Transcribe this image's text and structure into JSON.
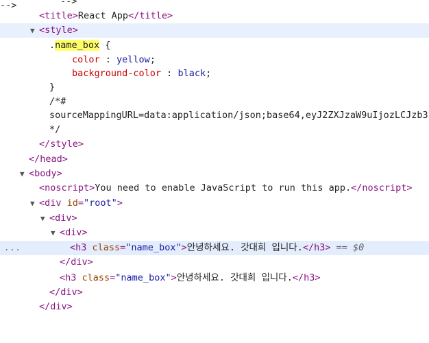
{
  "lines": {
    "comment_close": "-->",
    "title_open": "<title>",
    "title_text": "React App",
    "title_close": "</title>",
    "style_open": "<style>",
    "css_dot": ".",
    "css_selector": "name_box",
    "css_brace_open": " {",
    "css_prop_color": "color",
    "css_sep": " : ",
    "css_val_color": "yellow",
    "css_semicolon": ";",
    "css_prop_bg": "background-color",
    "css_val_bg": "black",
    "css_brace_close": "}",
    "comment_start": "/*#",
    "source_mapping": "sourceMappingURL=data:application/json;base64,eyJ2ZXJzaW9uIjozLCJzb3",
    "comment_end": "*/",
    "style_close": "</style>",
    "head_close": "</head>",
    "body_open": "<body>",
    "noscript_open": "<noscript>",
    "noscript_text": "You need to enable JavaScript to run this app.",
    "noscript_close": "</noscript>",
    "div_root_start": "<div ",
    "attr_id": "id",
    "attr_eq": "=",
    "val_root": "\"root\"",
    "tag_gt": ">",
    "div_open": "<div>",
    "h3_start": "<h3 ",
    "attr_class": "class",
    "val_name_box": "\"name_box\"",
    "h3_text": "안녕하세요. 갓대희 입니다.",
    "h3_close": "</h3>",
    "selected_marker": " == $0",
    "div_close": "</div>",
    "ellipsis": "..."
  }
}
